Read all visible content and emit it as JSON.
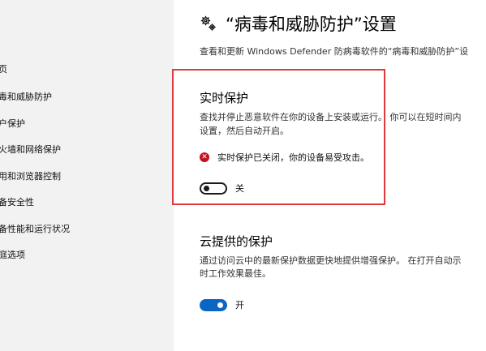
{
  "sidebar": {
    "items": [
      {
        "label": "主页"
      },
      {
        "label": "病毒和威胁防护"
      },
      {
        "label": "帐户保护"
      },
      {
        "label": "防火墙和网络保护"
      },
      {
        "label": "应用和浏览器控制"
      },
      {
        "label": "设备安全性"
      },
      {
        "label": "设备性能和运行状况"
      },
      {
        "label": "家庭选项"
      }
    ]
  },
  "header": {
    "title": "“病毒和威胁防护”设置",
    "subtitle": "查看和更新 Windows Defender 防病毒软件的“病毒和威胁防护”设"
  },
  "realtime": {
    "title": "实时保护",
    "desc_line1": "查找并停止恶意软件在你的设备上安装或运行。 你可以在短时间内",
    "desc_line2": "设置，然后自动开启。",
    "warning": "实时保护已关闭，你的设备易受攻击。",
    "toggle_label": "关",
    "toggle_state": "off"
  },
  "cloud": {
    "title": "云提供的保护",
    "desc_line1": "通过访问云中的最新保护数据更快地提供增强保护。 在打开自动示",
    "desc_line2": "时工作效果最佳。",
    "toggle_label": "开",
    "toggle_state": "on"
  },
  "colors": {
    "accent": "#0a66c2",
    "highlight_border": "#e0393e",
    "error": "#c50f1f",
    "sidebar_bg": "#f2f2f2"
  },
  "icons": {
    "title_icon": "gear-icon",
    "warning_icon": "error-icon"
  }
}
